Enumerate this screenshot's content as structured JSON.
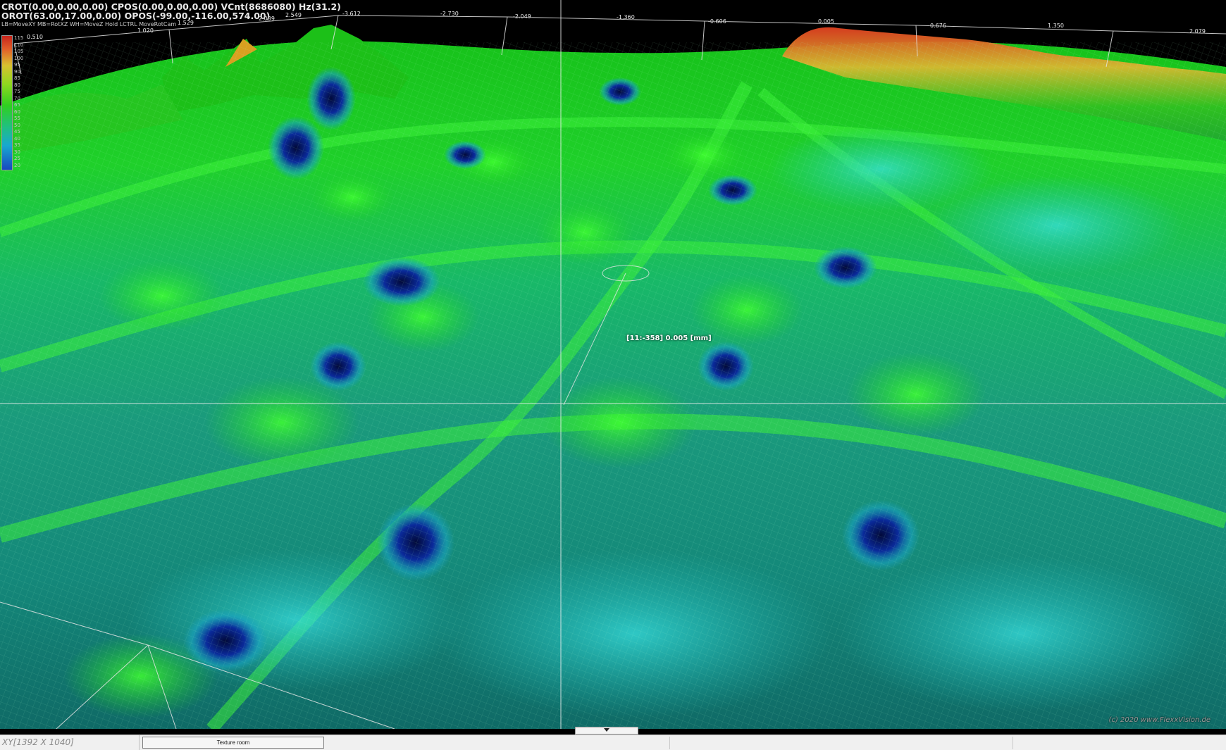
{
  "hud": {
    "line1": "CROT(0.00,0.00,0.00) CPOS(0.00,0.00,0.00) VCnt(8686080) Hz(31.2)",
    "line2": "OROT(63.00,17.00,0.00) OPOS(-99.00,-116.00,574.00)",
    "line3": "LB=MoveXY MB=RotXZ WH=MoveZ Hold LCTRL MoveRotCam"
  },
  "legend": {
    "values": [
      "115",
      "110",
      "105",
      "100",
      "95",
      "90",
      "85",
      "80",
      "75",
      "70",
      "65",
      "60",
      "55",
      "50",
      "45",
      "40",
      "35",
      "30",
      "25",
      "20"
    ]
  },
  "axis_ticks": {
    "labels": [
      "0.510",
      "1.020",
      "1.529",
      "2.039",
      "2.549",
      "-3.612",
      "-2.730",
      "-2.049",
      "-1.360",
      "-0.606",
      "0.005",
      "0.676",
      "1.350",
      "2.079"
    ]
  },
  "cursor_readout": "[11:-358] 0.005 [mm]",
  "copyright": "(c) 2020 www.FlexxVision.de",
  "statusbar": {
    "xy_label": "XY[1392 X 1040]",
    "texture_button": "Texture room"
  },
  "colors": {
    "peak": "#c8241c",
    "ridge": "#2fd020",
    "slope": "#20c0b0",
    "valley": "#1848c0",
    "background": "#000000"
  }
}
